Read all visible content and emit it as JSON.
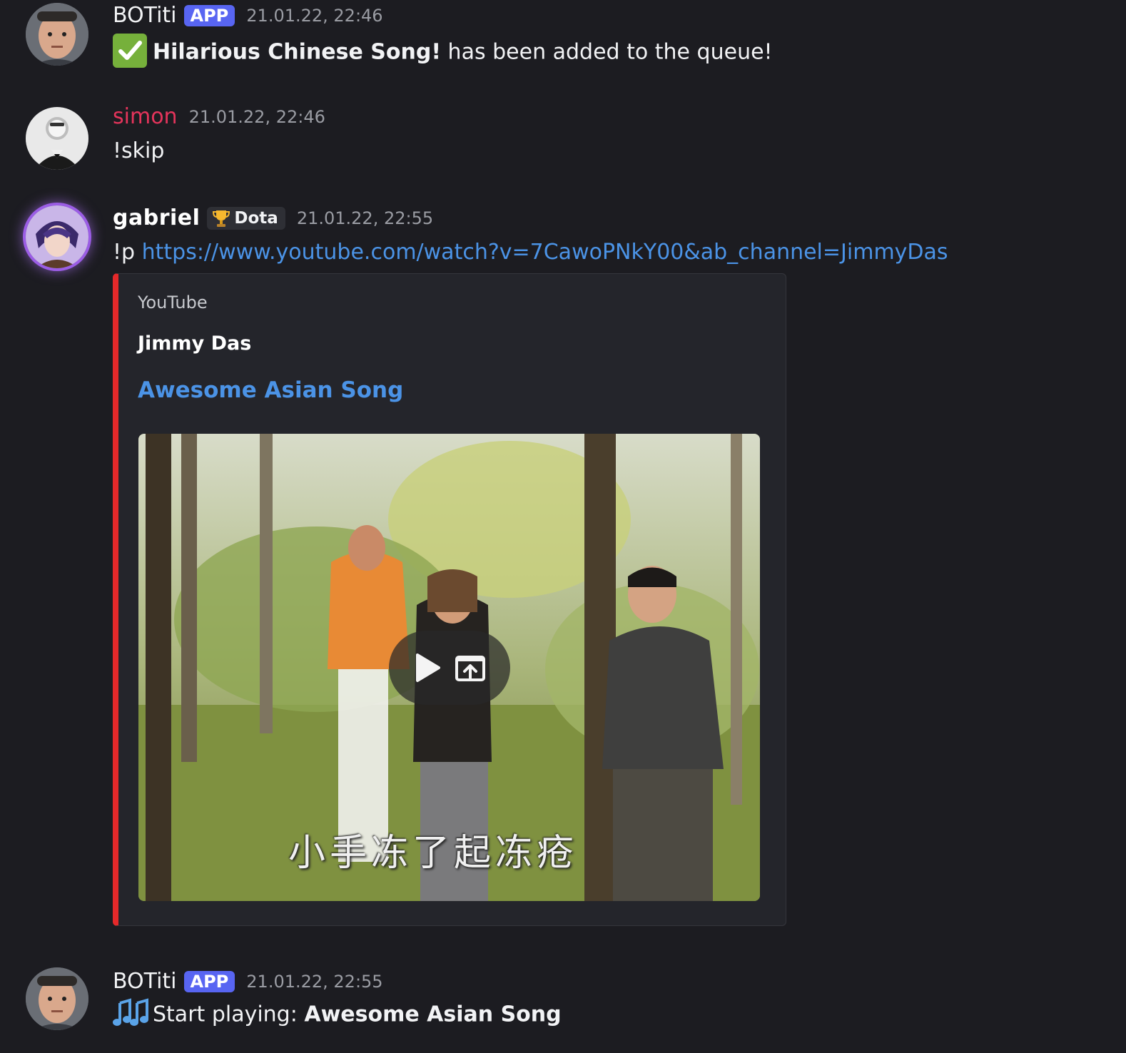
{
  "messages": [
    {
      "author": "BOTiti",
      "tag": "APP",
      "timestamp": "21.01.22, 22:46",
      "emoji": "check-mark-icon",
      "content_bold": "Hilarious Chinese Song!",
      "content_rest": " has been added to the queue!"
    },
    {
      "author": "simon",
      "timestamp": "21.01.22, 22:46",
      "content": "!skip"
    },
    {
      "author": "gabriel",
      "role_icon": "trophy-icon",
      "role": "Dota",
      "timestamp": "21.01.22, 22:55",
      "content_prefix": "!p ",
      "link": "https://www.youtube.com/watch?v=7CawoPNkY00&ab_channel=JimmyDas",
      "embed": {
        "provider": "YouTube",
        "author": "Jimmy Das",
        "title": "Awesome Asian Song",
        "video_caption": "小手冻了起冻疮",
        "controls": [
          "play-icon",
          "open-external-icon"
        ]
      }
    },
    {
      "author": "BOTiti",
      "tag": "APP",
      "timestamp": "21.01.22, 22:55",
      "emoji": "music-notes-icon",
      "content_prefix": "Start playing: ",
      "content_bold": "Awesome Asian Song"
    }
  ],
  "colors": {
    "background": "#1c1c21",
    "app_tag": "#5865f2",
    "simon_name": "#e4345b",
    "link": "#4b93e6",
    "embed_border": "#e5292a"
  }
}
